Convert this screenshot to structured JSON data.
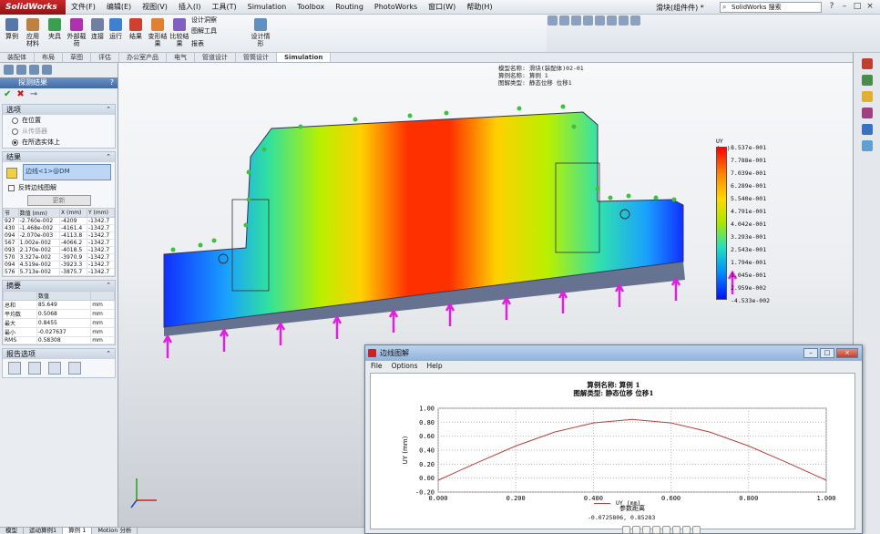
{
  "app": {
    "logo": "SolidWorks",
    "document_title": "滑块(组件件) *",
    "search_placeholder": "SolidWorks 搜索",
    "menu": [
      "文件(F)",
      "编辑(E)",
      "视图(V)",
      "插入(I)",
      "工具(T)",
      "Simulation",
      "Toolbox",
      "Routing",
      "PhotoWorks",
      "窗口(W)",
      "帮助(H)"
    ],
    "window_controls": [
      "?",
      "–",
      "□",
      "×"
    ]
  },
  "ribbon": {
    "buttons": [
      "算例",
      "应用材料",
      "夹具",
      "外部载荷",
      "连接",
      "运行",
      "结果",
      "变形结果",
      "比较结果",
      "设计洞察",
      "图解工具",
      "报表",
      "设计情形"
    ]
  },
  "tabs": [
    "装配体",
    "布局",
    "草图",
    "评估",
    "办公室产品",
    "电气",
    "管道设计",
    "管筒设计",
    "Simulation"
  ],
  "active_tab": "Simulation",
  "property_manager": {
    "title": "探测结果",
    "help": "?",
    "options_header": "选项",
    "options": [
      {
        "label": "在位置",
        "selected": false,
        "enabled": true
      },
      {
        "label": "从传感器",
        "selected": false,
        "enabled": false
      },
      {
        "label": "在所选实体上",
        "selected": true,
        "enabled": true
      }
    ],
    "results_header": "结果",
    "selection_text": "边线<1>@DM",
    "reverse_edge_label": "反转边线图解",
    "update_label": "更新",
    "table_headers": [
      "节",
      "数值 (mm)",
      "X (mm)",
      "Y (mm)"
    ],
    "table_rows": [
      [
        "927",
        "-2.760e-002",
        "-4209",
        "-1342.7"
      ],
      [
        "430",
        "-1.468e-002",
        "-4161.4",
        "-1342.7"
      ],
      [
        "094",
        "-2.070e-003",
        "-4113.8",
        "-1342.7"
      ],
      [
        "567",
        "1.002e-002",
        "-4066.2",
        "-1342.7"
      ],
      [
        "093",
        "2.170e-002",
        "-4018.5",
        "-1342.7"
      ],
      [
        "570",
        "3.327e-002",
        "-3970.9",
        "-1342.7"
      ],
      [
        "094",
        "4.519e-002",
        "-3923.3",
        "-1342.7"
      ],
      [
        "576",
        "5.713e-002",
        "-3875.7",
        "-1342.7"
      ]
    ],
    "summary_header": "摘要",
    "summary_headers": [
      "",
      "数值",
      ""
    ],
    "summary_rows": [
      [
        "总和",
        "85.649",
        "mm"
      ],
      [
        "平均数",
        "0.5068",
        "mm"
      ],
      [
        "最大",
        "0.8455",
        "mm"
      ],
      [
        "最小",
        "-0.027637",
        "mm"
      ],
      [
        "RMS",
        "0.58308",
        "mm"
      ]
    ],
    "report_header": "报告选项"
  },
  "plot_info": {
    "model_name": "模型名称: 滑块(装配体)02-01",
    "study_name": "算例名称: 算例 1",
    "plot_type": "图解类型: 静态位移 位移1"
  },
  "legend": {
    "title": "UY (mm)",
    "labels": [
      "8.537e-001",
      "7.788e-001",
      "7.039e-001",
      "6.289e-001",
      "5.540e-001",
      "4.791e-001",
      "4.042e-001",
      "3.293e-001",
      "2.543e-001",
      "1.794e-001",
      "1.045e-001",
      "2.959e-002",
      "-4.533e-002"
    ]
  },
  "status_bar": [
    "模型",
    "运动算例1",
    "算例 1",
    "Motion 分析"
  ],
  "graph_dialog": {
    "title": "边线图解",
    "menu": [
      "File",
      "Options",
      "Help"
    ],
    "controls": [
      "–",
      "□",
      "×"
    ],
    "graph_title_line1": "算例名称: 算例 1",
    "graph_title_line2": "图解类型: 静态位移 位移1",
    "readout": "-0.0725806, 0.85283",
    "chart_data": {
      "type": "line",
      "title": "算例名称: 算例 1 / 图解类型: 静态位移 位移1",
      "xlabel": "参数距离",
      "ylabel": "UY (mm)",
      "xlim": [
        0.0,
        1.0
      ],
      "ylim": [
        -0.2,
        1.0
      ],
      "x_ticks": [
        "0.000",
        "0.200",
        "0.400",
        "0.600",
        "0.800",
        "1.000"
      ],
      "y_ticks": [
        "1.00",
        "0.80",
        "0.60",
        "0.40",
        "0.20",
        "0.00",
        "-0.20"
      ],
      "grid": true,
      "legend_position": "bottom",
      "series": [
        {
          "name": "UY (mm)",
          "color": "#b84040",
          "x": [
            0.0,
            0.1,
            0.2,
            0.3,
            0.4,
            0.5,
            0.6,
            0.7,
            0.8,
            0.9,
            1.0
          ],
          "y": [
            -0.03,
            0.22,
            0.46,
            0.66,
            0.79,
            0.84,
            0.79,
            0.66,
            0.46,
            0.22,
            -0.03
          ]
        }
      ]
    }
  }
}
